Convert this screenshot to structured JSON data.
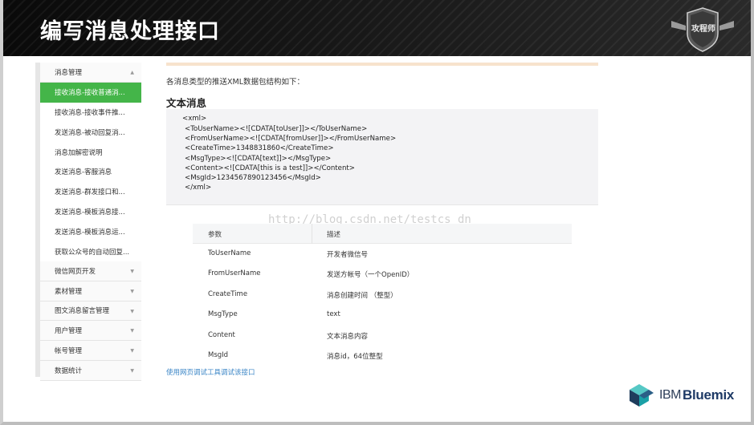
{
  "slide": {
    "title": "编写消息处理接口",
    "badge_text": "攻程师"
  },
  "sidebar": {
    "items": [
      {
        "label": "消息管理",
        "type": "group",
        "caret": "▲"
      },
      {
        "label": "接收消息-接收普通消...",
        "type": "active"
      },
      {
        "label": "接收消息-接收事件推...",
        "type": "sub"
      },
      {
        "label": "发送消息-被动回复消...",
        "type": "sub"
      },
      {
        "label": "消息加解密说明",
        "type": "sub"
      },
      {
        "label": "发送消息-客服消息",
        "type": "sub"
      },
      {
        "label": "发送消息-群发接口和...",
        "type": "sub"
      },
      {
        "label": "发送消息-模板消息接...",
        "type": "sub"
      },
      {
        "label": "发送消息-模板消息运...",
        "type": "sub"
      },
      {
        "label": "获取公众号的自动回复...",
        "type": "sub"
      },
      {
        "label": "微信网页开发",
        "type": "group",
        "caret": "▼"
      },
      {
        "label": "素材管理",
        "type": "group",
        "caret": "▼"
      },
      {
        "label": "图文消息留言管理",
        "type": "group",
        "caret": "▼"
      },
      {
        "label": "用户管理",
        "type": "group",
        "caret": "▼"
      },
      {
        "label": "帐号管理",
        "type": "group",
        "caret": "▼"
      },
      {
        "label": "数据统计",
        "type": "group",
        "caret": "▼"
      }
    ]
  },
  "content": {
    "intro": "各消息类型的推送XML数据包结构如下：",
    "section_title": "文本消息",
    "code_lines": [
      "<xml>",
      "<ToUserName><![CDATA[toUser]]></ToUserName>",
      "<FromUserName><![CDATA[fromUser]]></FromUserName>",
      "<CreateTime>1348831860</CreateTime>",
      "<MsgType><![CDATA[text]]></MsgType>",
      "<Content><![CDATA[this is a test]]></Content>",
      "<MsgId>1234567890123456</MsgId>",
      "</xml>"
    ],
    "watermark": "http://blog.csdn.net/testcs_dn",
    "table": {
      "headers": [
        "参数",
        "描述"
      ],
      "rows": [
        [
          "ToUserName",
          "开发者微信号"
        ],
        [
          "FromUserName",
          "发送方帐号（一个OpenID）"
        ],
        [
          "CreateTime",
          "消息创建时间 （整型）"
        ],
        [
          "MsgType",
          "text"
        ],
        [
          "Content",
          "文本消息内容"
        ],
        [
          "MsgId",
          "消息id，64位整型"
        ]
      ]
    },
    "debug_link": "使用网页调试工具调试该接口"
  },
  "logo": {
    "ibm": "IBM",
    "product": "Bluemix",
    "colors": {
      "cube_dark": "#1f3d5c",
      "cube_teal": "#1aa0a6",
      "cube_light": "#56c8c5"
    }
  },
  "colors": {
    "accent_green": "#44b549",
    "link_blue": "#3a85c6",
    "code_bg": "#f3f3f5"
  }
}
